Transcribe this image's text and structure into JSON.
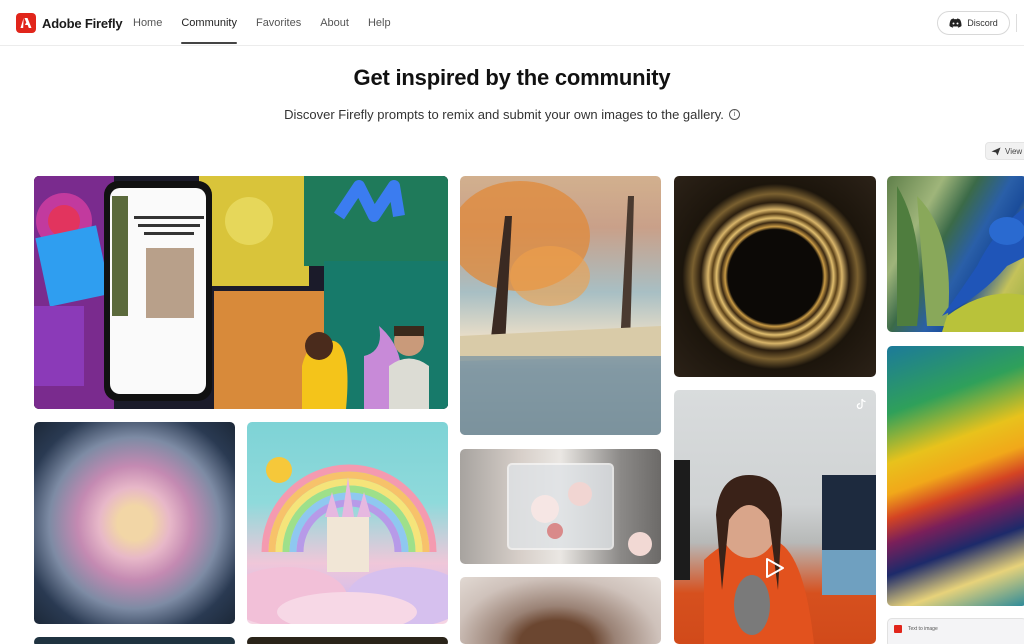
{
  "header": {
    "brand": "Adobe Firefly",
    "nav": [
      {
        "label": "Home",
        "active": false
      },
      {
        "label": "Community",
        "active": true
      },
      {
        "label": "Favorites",
        "active": false
      },
      {
        "label": "About",
        "active": false
      },
      {
        "label": "Help",
        "active": false
      }
    ],
    "discord_label": "Discord"
  },
  "hero": {
    "title": "Get inspired by the community",
    "subtitle": "Discover Firefly prompts to remix and submit your own images to the gallery.",
    "info_icon": "i"
  },
  "toolbar": {
    "view_label": "View"
  },
  "gallery": {
    "tiles": [
      {
        "id": "promo",
        "desc": "Firefly mobile app promo with two presenters",
        "type": "image"
      },
      {
        "id": "forest",
        "desc": "Watercolor autumn forest river",
        "type": "image"
      },
      {
        "id": "ring",
        "desc": "Golden glowing ring on black",
        "type": "image"
      },
      {
        "id": "bird",
        "desc": "Blue bird among banana leaves",
        "type": "image"
      },
      {
        "id": "flower",
        "desc": "Frozen pink and cream flower in water splash",
        "type": "image"
      },
      {
        "id": "rainbow",
        "desc": "Paper-craft rainbow with castle and clouds",
        "type": "image"
      },
      {
        "id": "ice",
        "desc": "Cherry blossoms frozen in ice cube",
        "type": "image"
      },
      {
        "id": "woman",
        "desc": "Portrait of woman with bokeh",
        "type": "image"
      },
      {
        "id": "video",
        "desc": "Woman speaking into microphone (TikTok video)",
        "type": "video"
      },
      {
        "id": "paint",
        "desc": "Colorful flowing paint swirl",
        "type": "image"
      },
      {
        "id": "app",
        "desc": "Firefly app screenshot",
        "type": "image",
        "caption": "Text to image"
      }
    ]
  },
  "colors": {
    "brand": "#e1251b",
    "text": "#111111",
    "nav_active_underline": "#444444"
  }
}
